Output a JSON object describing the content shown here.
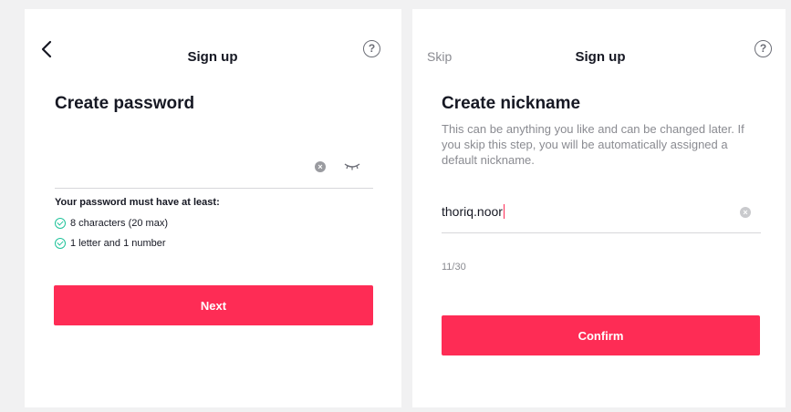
{
  "left": {
    "header": {
      "title": "Sign up",
      "help_icon": "?"
    },
    "heading": "Create password",
    "password_value": "",
    "requirements": {
      "title": "Your password must have at least:",
      "items": [
        "8 characters (20 max)",
        "1 letter and 1 number"
      ]
    },
    "next_label": "Next"
  },
  "right": {
    "header": {
      "skip_label": "Skip",
      "title": "Sign up",
      "help_icon": "?"
    },
    "heading": "Create nickname",
    "description": "This can be anything you like and can be changed later. If you skip this step, you will be automatically assigned a default nickname.",
    "nickname_value": "thoriq.noor",
    "counter": "11/30",
    "confirm_label": "Confirm"
  },
  "colors": {
    "accent": "#fe2c55",
    "check": "#20c39a",
    "muted": "#8a8b91"
  }
}
